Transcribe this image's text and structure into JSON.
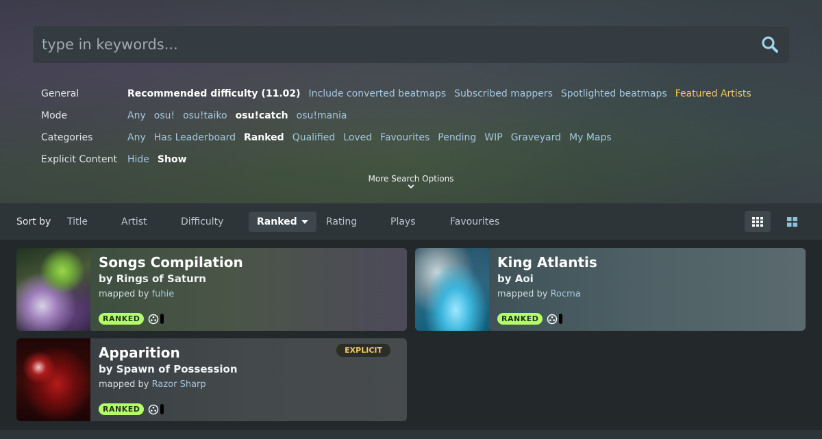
{
  "search": {
    "placeholder": "type in keywords..."
  },
  "filters": {
    "general": {
      "label": "General",
      "options": [
        "Recommended difficulty (11.02)",
        "Include converted beatmaps",
        "Subscribed mappers",
        "Spotlighted beatmaps",
        "Featured Artists"
      ]
    },
    "mode": {
      "label": "Mode",
      "options": [
        "Any",
        "osu!",
        "osu!taiko",
        "osu!catch",
        "osu!mania"
      ]
    },
    "categories": {
      "label": "Categories",
      "options": [
        "Any",
        "Has Leaderboard",
        "Ranked",
        "Qualified",
        "Loved",
        "Favourites",
        "Pending",
        "WIP",
        "Graveyard",
        "My Maps"
      ]
    },
    "explicit": {
      "label": "Explicit Content",
      "options": [
        "Hide",
        "Show"
      ]
    }
  },
  "more_options_label": "More Search Options",
  "sort": {
    "label": "Sort by",
    "options": [
      "Title",
      "Artist",
      "Difficulty",
      "Ranked",
      "Rating",
      "Plays",
      "Favourites"
    ],
    "active": "Ranked"
  },
  "colors": {
    "accent_link": "#a4c7df",
    "featured": "#f5c75e",
    "ranked_badge": "#b3ff66"
  },
  "beatmaps": [
    {
      "title": "Songs Compilation",
      "artist": "by Rings of Saturn",
      "mapped_prefix": "mapped by",
      "mapper": "fuhie",
      "status": "RANKED",
      "explicit": ""
    },
    {
      "title": "King Atlantis",
      "artist": "by Aoi",
      "mapped_prefix": "mapped by",
      "mapper": "Rocma",
      "status": "RANKED",
      "explicit": ""
    },
    {
      "title": "Apparition",
      "artist": "by Spawn of Possession",
      "mapped_prefix": "mapped by",
      "mapper": "Razor Sharp",
      "status": "RANKED",
      "explicit": "EXPLICIT"
    }
  ]
}
